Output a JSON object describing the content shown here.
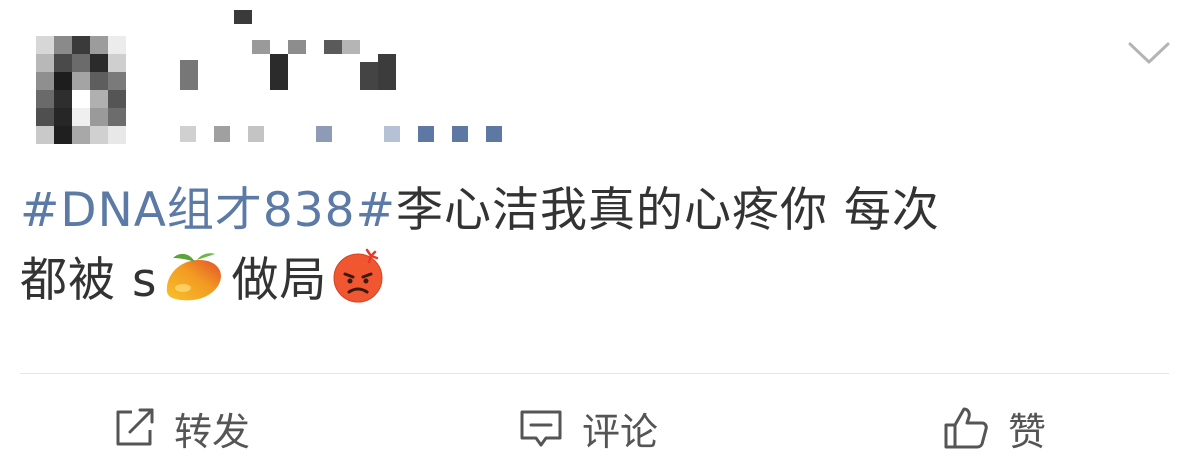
{
  "post": {
    "content": {
      "topic": "#DNA组才838#",
      "text_line1": "李心洁我真的心疼你 每次",
      "text_line2_a": "都被 s",
      "text_line2_b": "做局",
      "emojis": [
        "mango-icon",
        "angry-face-icon"
      ]
    },
    "actions": {
      "repost_label": "转发",
      "comment_label": "评论",
      "like_label": "赞"
    },
    "colors": {
      "topic": "#5b7aa5",
      "text": "#333333",
      "action_text": "#555555"
    }
  }
}
